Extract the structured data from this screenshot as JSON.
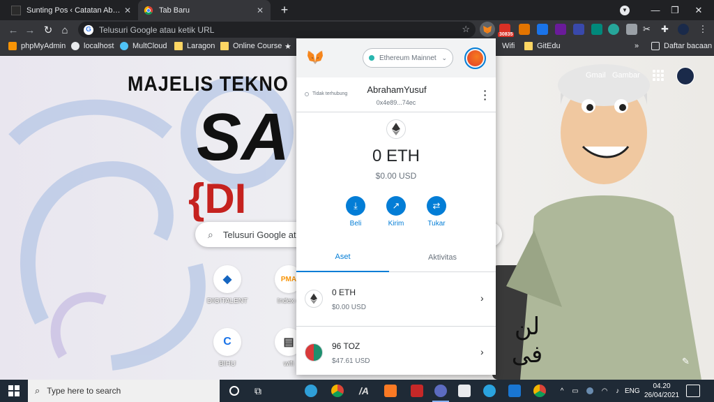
{
  "browser": {
    "tabs": [
      {
        "title": "Sunting Pos ‹ Catatan Abraham Y",
        "active": false
      },
      {
        "title": "Tab Baru",
        "active": true
      }
    ],
    "omnibox_placeholder": "Telusuri Google atau ketik URL",
    "extension_badge": "30835",
    "bookmarks": [
      "phpMyAdmin",
      "localhost",
      "MultCloud",
      "Laragon",
      "Online Course",
      "Wifi",
      "GitEdu"
    ],
    "bookmarks_overflow": "»",
    "reading_list": "Daftar bacaan"
  },
  "newtab": {
    "headline": "MAJELIS TEKNO",
    "big_text_1": "SA",
    "big_text_2": "{DI",
    "search_placeholder": "Telusuri Google at",
    "gmail": "Gmail",
    "images": "Gambar",
    "shortcuts": [
      {
        "label": "DIGITALENT",
        "icon": "digitalent-icon"
      },
      {
        "label": "Index o",
        "icon": "pma-icon"
      },
      {
        "label": "BIHU",
        "icon": "bihu-icon"
      },
      {
        "label": "wifi",
        "icon": "wifi-icon"
      }
    ],
    "arabic_text": "لن\nفى"
  },
  "metamask": {
    "network": "Ethereum Mainnet",
    "connection_status": "Tidak terhubung",
    "account_name": "AbrahamYusuf",
    "account_address": "0x4e89...74ec",
    "balance": "0 ETH",
    "balance_usd": "$0.00 USD",
    "actions": [
      {
        "label": "Beli",
        "icon": "download-icon"
      },
      {
        "label": "Kirim",
        "icon": "arrow-up-right-icon"
      },
      {
        "label": "Tukar",
        "icon": "swap-icon"
      }
    ],
    "tabs": [
      {
        "label": "Aset",
        "active": true
      },
      {
        "label": "Aktivitas",
        "active": false
      }
    ],
    "assets": [
      {
        "amount": "0 ETH",
        "usd": "$0.00 USD",
        "icon": "eth-icon"
      },
      {
        "amount": "96 TOZ",
        "usd": "$47.61 USD",
        "icon": "toz-icon"
      }
    ],
    "accent_color": "#037dd6"
  },
  "taskbar": {
    "search_placeholder": "Type here to search",
    "language": "ENG",
    "time": "04.20",
    "date": "26/04/2021"
  }
}
